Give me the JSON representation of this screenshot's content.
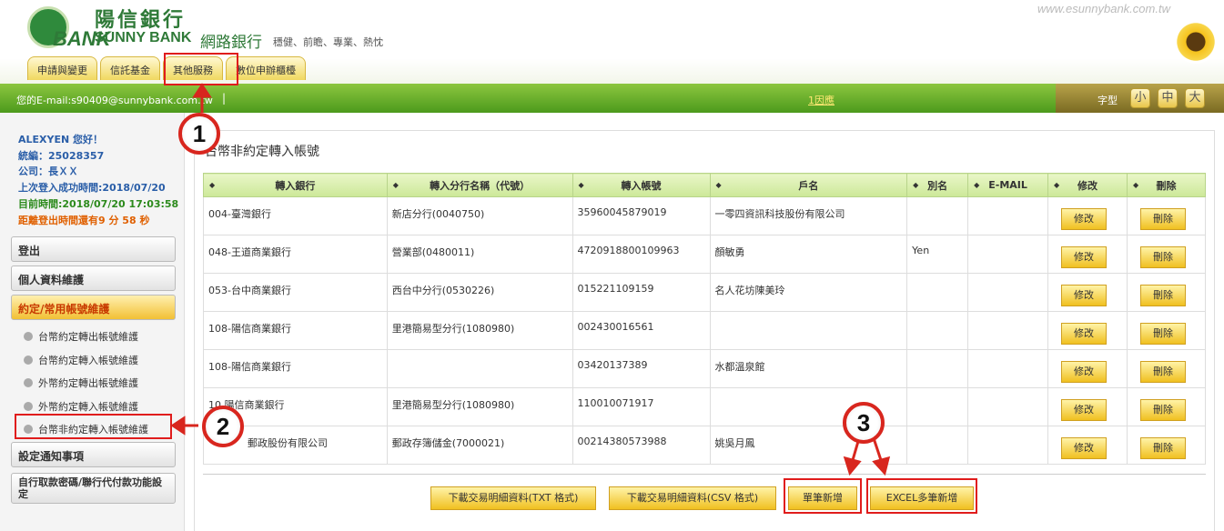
{
  "brand": {
    "name_cn": "陽信銀行",
    "name_en": "SUNNY BANK",
    "logo_mark": "BANK",
    "net_banking": "網路銀行",
    "slogan": "穩健、前瞻、專業、熱忱",
    "site_url": "www.esunnybank.com.tw"
  },
  "tabs": [
    "申請與變更",
    "信託基金",
    "其他服務",
    "數位申辦櫃檯"
  ],
  "bar": {
    "email": "您的E-mail:s90409@sunnybank.com.tw",
    "separator": "|",
    "notice": "1因應",
    "font_label": "字型",
    "font_sizes": [
      "小",
      "中",
      "大"
    ]
  },
  "user": {
    "greeting": "ALEXYEN 您好！",
    "tax_id": "統編：25028357",
    "company": "公司：長ＸＸ",
    "last_login": "上次登入成功時間:2018/07/20",
    "current_time": "目前時間:2018/07/20 17:03:58",
    "logout_timer": "距離登出時間還有9 分 58 秒"
  },
  "menu": {
    "logout": "登出",
    "personal": "個人資料維護",
    "accounts": "約定/常用帳號維護",
    "sub": [
      "台幣約定轉出帳號維護",
      "台幣約定轉入帳號維護",
      "外幣約定轉出帳號維護",
      "外幣約定轉入帳號維護",
      "台幣非約定轉入帳號維護"
    ],
    "notify": "設定通知事項",
    "atm": "自行取款密碼/聯行代付款功能設定"
  },
  "page": {
    "title": "台幣非約定轉入帳號"
  },
  "table": {
    "headers": [
      "轉入銀行",
      "轉入分行名稱（代號）",
      "轉入帳號",
      "戶名",
      "別名",
      "E-MAIL",
      "修改",
      "刪除"
    ],
    "edit_label": "修改",
    "delete_label": "刪除",
    "rows": [
      {
        "bank": "004-臺灣銀行",
        "branch": "新店分行(0040750)",
        "account": "35960045879019",
        "name": "一零四資訊科技股份有限公司",
        "alias": "",
        "email": ""
      },
      {
        "bank": "048-王道商業銀行",
        "branch": "營業部(0480011)",
        "account": "4720918800109963",
        "name": "顏敏勇",
        "alias": "Yen",
        "email": ""
      },
      {
        "bank": "053-台中商業銀行",
        "branch": "西台中分行(0530226)",
        "account": "015221109159",
        "name": "名人花坊陳美玲",
        "alias": "",
        "email": ""
      },
      {
        "bank": "108-陽信商業銀行",
        "branch": "里港簡易型分行(1080980)",
        "account": "002430016561",
        "name": "",
        "alias": "",
        "email": ""
      },
      {
        "bank": "108-陽信商業銀行",
        "branch": "",
        "account": "03420137389",
        "name": "水都溫泉館",
        "alias": "",
        "email": ""
      },
      {
        "bank": "10 陽信商業銀行",
        "branch": "里港簡易型分行(1080980)",
        "account": "110010071917",
        "name": "",
        "alias": "",
        "email": ""
      },
      {
        "bank": "郵政股份有限公司",
        "branch": "郵政存簿儲金(7000021)",
        "account": "00214380573988",
        "name": "姚吳月鳳",
        "alias": "",
        "email": ""
      }
    ]
  },
  "actions": {
    "download_txt": "下載交易明細資料(TXT 格式)",
    "download_csv": "下載交易明細資料(CSV 格式)",
    "add_single": "單筆新增",
    "add_excel": "EXCEL多筆新增"
  },
  "callouts": [
    "1",
    "2",
    "3"
  ]
}
